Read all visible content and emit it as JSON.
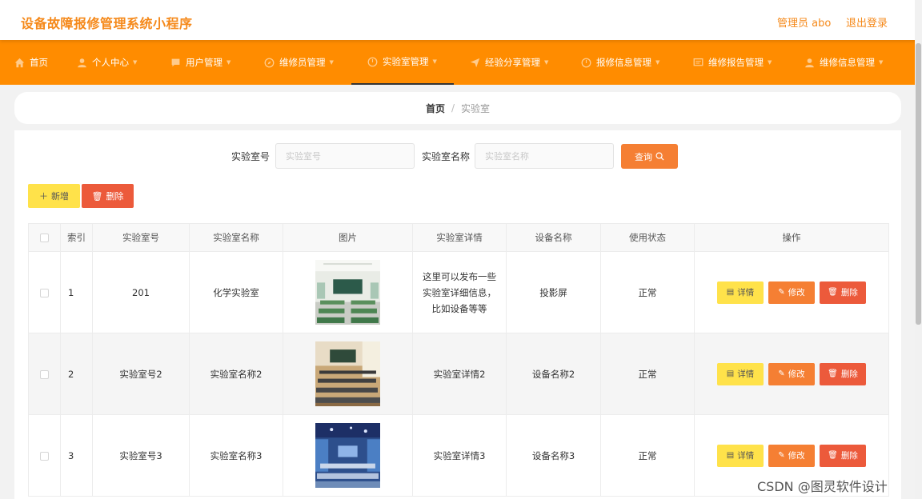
{
  "header": {
    "title": "设备故障报修管理系统小程序",
    "admin": "管理员 abo",
    "logout": "退出登录"
  },
  "nav": {
    "items": [
      {
        "label": "首页",
        "icon": "home-icon",
        "caret": false
      },
      {
        "label": "个人中心",
        "icon": "person-icon",
        "caret": true
      },
      {
        "label": "用户管理",
        "icon": "chat-icon",
        "caret": true
      },
      {
        "label": "维修员管理",
        "icon": "compass-icon",
        "caret": true
      },
      {
        "label": "实验室管理",
        "icon": "clock-icon",
        "caret": true,
        "active": true
      },
      {
        "label": "经验分享管理",
        "icon": "send-icon",
        "caret": true
      },
      {
        "label": "报修信息管理",
        "icon": "clock-icon",
        "caret": true
      },
      {
        "label": "维修报告管理",
        "icon": "message-icon",
        "caret": true
      },
      {
        "label": "维修信息管理",
        "icon": "person-icon",
        "caret": true
      }
    ]
  },
  "breadcrumb": {
    "home": "首页",
    "separator": "/",
    "current": "实验室"
  },
  "search": {
    "lab_no_label": "实验室号",
    "lab_no_placeholder": "实验室号",
    "lab_name_label": "实验室名称",
    "lab_name_placeholder": "实验室名称",
    "query_button": "查询"
  },
  "actions": {
    "add": "新增",
    "delete": "删除"
  },
  "table": {
    "columns": [
      "索引",
      "实验室号",
      "实验室名称",
      "图片",
      "实验室详情",
      "设备名称",
      "使用状态",
      "操作"
    ],
    "rows": [
      {
        "index": "1",
        "lab_no": "201",
        "lab_name": "化学实验室",
        "detail": "这里可以发布一些实验室详细信息，比如设备等等",
        "device": "投影屏",
        "status": "正常",
        "image": "lab-photo-1"
      },
      {
        "index": "2",
        "lab_no": "实验室号2",
        "lab_name": "实验室名称2",
        "detail": "实验室详情2",
        "device": "设备名称2",
        "status": "正常",
        "image": "lab-photo-2"
      },
      {
        "index": "3",
        "lab_no": "实验室号3",
        "lab_name": "实验室名称3",
        "detail": "实验室详情3",
        "device": "设备名称3",
        "status": "正常",
        "image": "lab-photo-3"
      }
    ],
    "row_actions": {
      "detail": "详情",
      "edit": "修改",
      "delete": "删除"
    }
  },
  "watermark": "CSDN @图灵软件设计",
  "colors": {
    "accent": "#ff8c00",
    "title": "#f5891a",
    "yellow": "#ffe24a",
    "orange": "#f57f33",
    "red": "#ec5a3b"
  }
}
